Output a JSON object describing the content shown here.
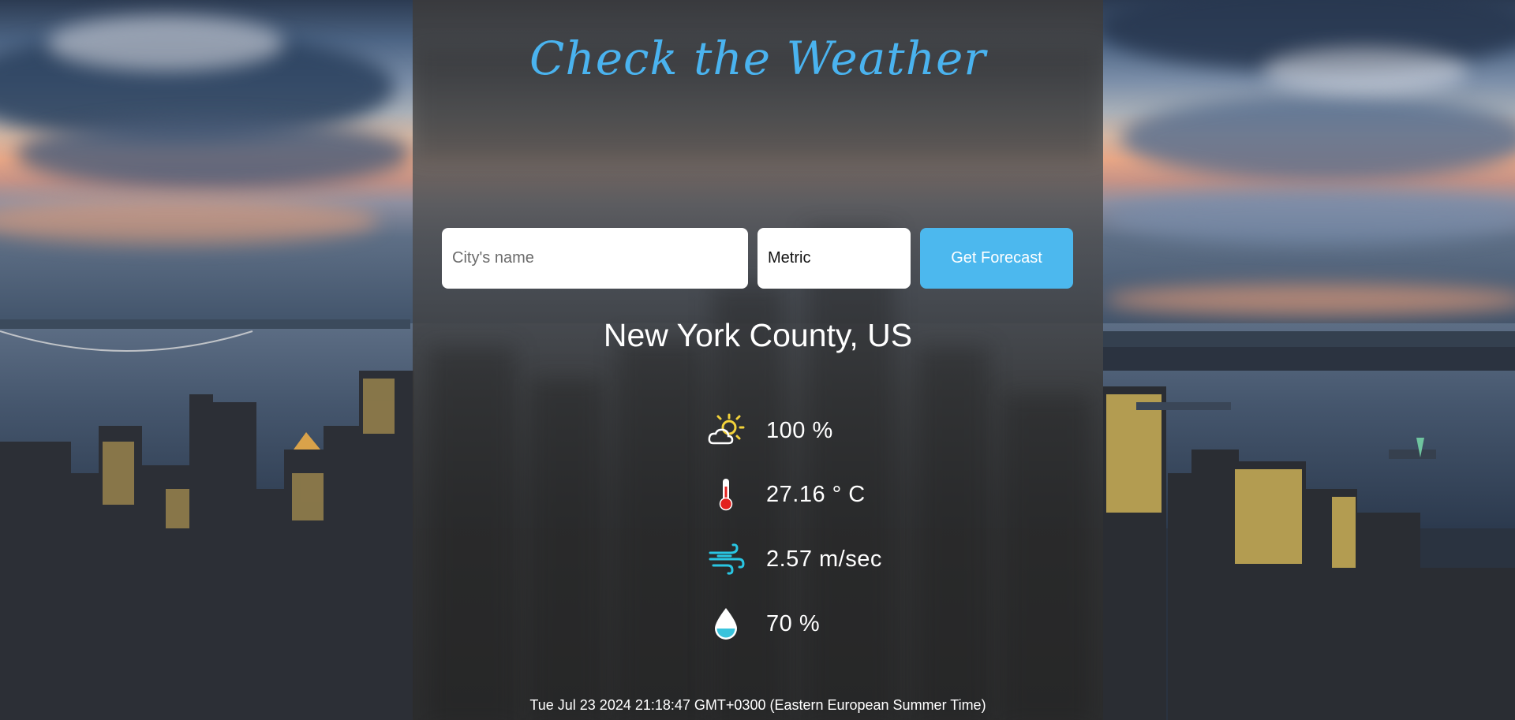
{
  "app": {
    "title": "Check the Weather"
  },
  "search": {
    "city_placeholder": "City's name",
    "city_value": "",
    "units_selected": "Metric",
    "button_label": "Get Forecast"
  },
  "weather": {
    "location": "New York County, US",
    "cloudiness": "100 %",
    "temperature": "27.16 ° C",
    "wind_speed": "2.57 m/sec",
    "humidity": "70 %"
  },
  "timestamp": "Tue Jul 23 2024 21:18:47 GMT+0300 (Eastern European Summer Time)",
  "colors": {
    "accent": "#4cb8ee",
    "title": "#4ab3ef",
    "panel": "#3c3c3c",
    "sun_icon": "#f2d23a",
    "thermometer_bulb": "#e3221f",
    "wind_icon": "#29c6e3",
    "humidity_icon": "#39c3dc"
  },
  "icons": {
    "cloudiness": "partly-cloudy-icon",
    "temperature": "thermometer-icon",
    "wind": "wind-icon",
    "humidity": "water-drop-icon"
  }
}
